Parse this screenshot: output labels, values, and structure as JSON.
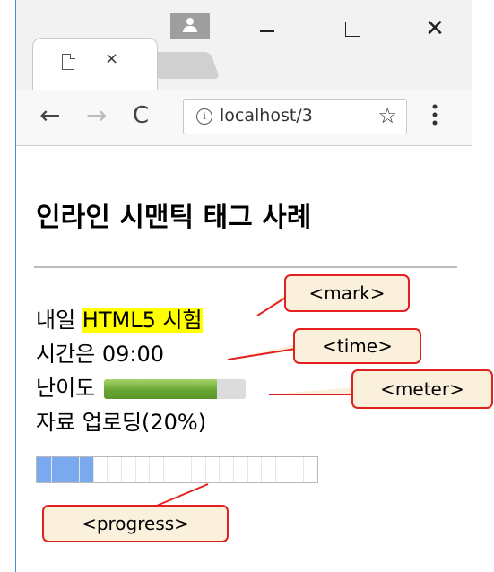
{
  "browser": {
    "tab_close": "×",
    "window_close": "✕",
    "nav_back": "←",
    "nav_forward": "→",
    "nav_reload": "C",
    "info_symbol": "i",
    "address": "localhost/3",
    "bookmark_star": "☆",
    "menu": "⋮"
  },
  "page": {
    "heading": "인라인 시맨틱 태그 사례",
    "mark_prefix": "내일 ",
    "mark_text": "HTML5 시험",
    "time_prefix": "시간은 ",
    "time_value": "09:00",
    "meter_label": "난이도 ",
    "meter_value": 0.8,
    "upload_label": "자료 업로딩(20%)",
    "progress_value": 0.2
  },
  "callouts": {
    "mark": "<mark>",
    "time": "<time>",
    "meter": "<meter>",
    "progress": "<progress>"
  },
  "colors": {
    "window_border": "#4a90d9",
    "mark_highlight": "#ffff00",
    "meter_fill": "#6aa632",
    "progress_fill": "#7aa9f0",
    "callout_border": "#e32020",
    "callout_fill": "#fbf0dc"
  }
}
